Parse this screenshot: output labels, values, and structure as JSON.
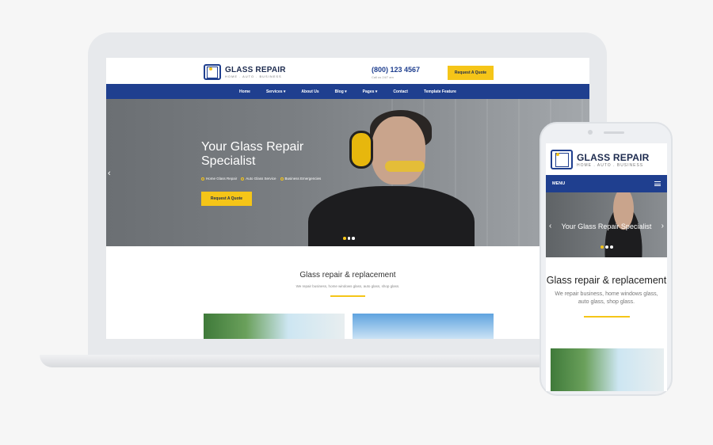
{
  "brand": {
    "name": "GLASS REPAIR",
    "tagline": "HOME . AUTO . BUSINESS",
    "accent": "#f5c518",
    "primary": "#1f3f8f"
  },
  "desktop": {
    "header": {
      "phone": "(800) 123 4567",
      "phone_sub": "Call us 24/7 am",
      "cta": "Request A Quote"
    },
    "nav": [
      "Home",
      "Services ▾",
      "About Us",
      "Blog ▾",
      "Pages ▾",
      "Contact",
      "Template Feature"
    ],
    "hero": {
      "title": "Your Glass Repair Specialist",
      "bullets": [
        "Home Glass Repair",
        "Auto Glass Service",
        "Business Emergencies"
      ],
      "cta": "Request A Quote",
      "prev_arrow": "‹",
      "slides": 3,
      "active_slide": 1
    },
    "section": {
      "title": "Glass repair & replacement",
      "subtitle": "We repair business, home windows glass, auto glass, shop glass."
    }
  },
  "mobile": {
    "nav": {
      "menu_label": "MENU"
    },
    "hero": {
      "title": "Your Glass Repair Specialist",
      "prev_arrow": "‹",
      "next_arrow": "›",
      "slides": 3,
      "active_slide": 1
    },
    "section": {
      "title": "Glass repair & replacement",
      "subtitle": "We repair business, home windows glass, auto glass, shop glass."
    }
  }
}
